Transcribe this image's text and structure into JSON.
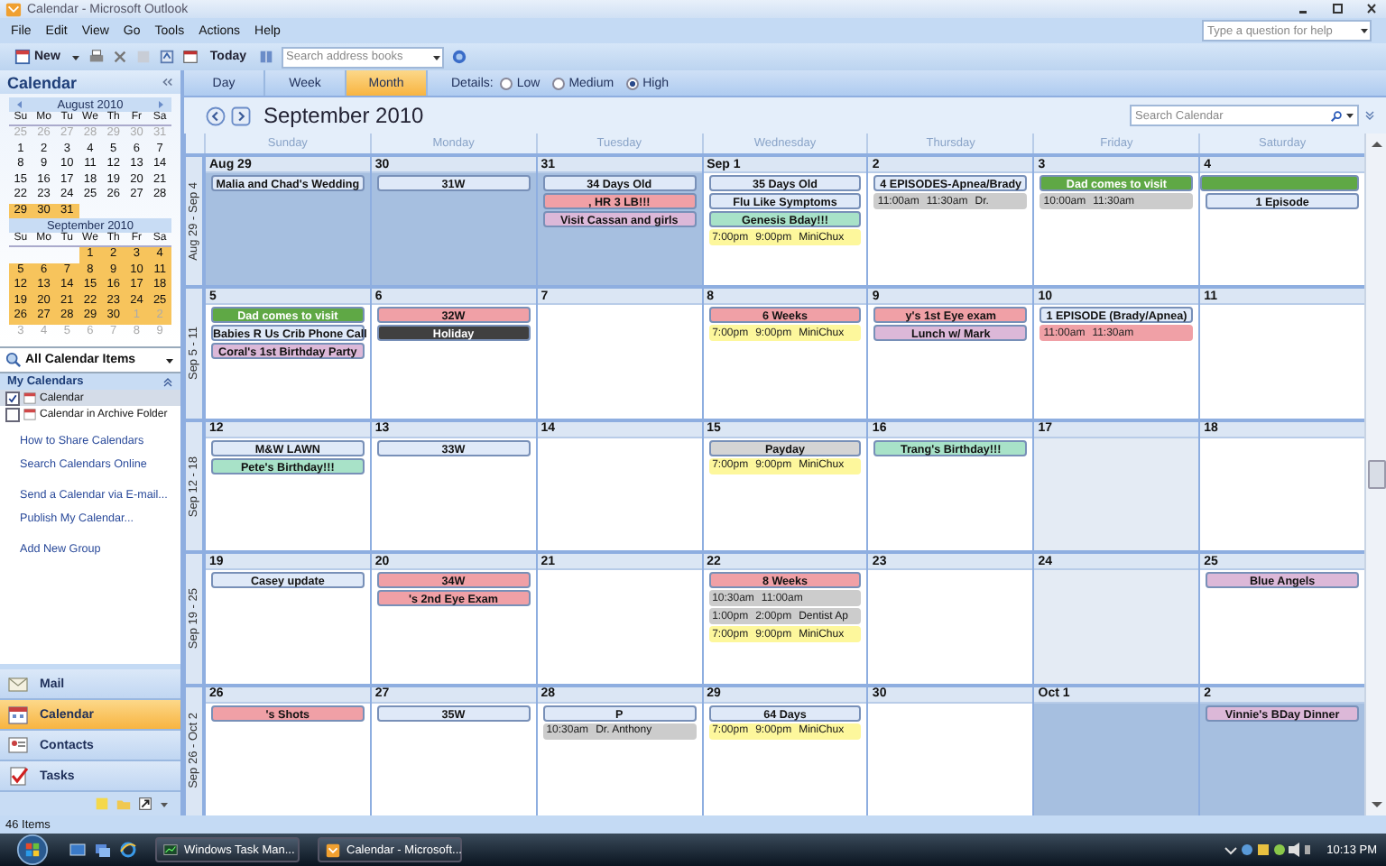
{
  "window": {
    "title": "Calendar - Microsoft Outlook"
  },
  "menu": [
    "File",
    "Edit",
    "View",
    "Go",
    "Tools",
    "Actions",
    "Help"
  ],
  "help_search": {
    "placeholder": "Type a question for help"
  },
  "toolbar": {
    "new_label": "New",
    "today_label": "Today",
    "address_search": {
      "placeholder": "Search address books"
    }
  },
  "sidebar": {
    "title": "Calendar",
    "mini_calendars": [
      {
        "title": "August 2010",
        "weekdays": [
          "Su",
          "Mo",
          "Tu",
          "We",
          "Th",
          "Fr",
          "Sa"
        ],
        "weeks": [
          [
            {
              "d": "25",
              "muted": true,
              "selected": false
            },
            {
              "d": "26",
              "muted": true,
              "selected": false
            },
            {
              "d": "27",
              "muted": true,
              "selected": false
            },
            {
              "d": "28",
              "muted": true,
              "selected": false
            },
            {
              "d": "29",
              "muted": true,
              "selected": false
            },
            {
              "d": "30",
              "muted": true,
              "selected": false
            },
            {
              "d": "31",
              "muted": true,
              "selected": false
            }
          ],
          [
            {
              "d": "1",
              "muted": false,
              "selected": false
            },
            {
              "d": "2",
              "muted": false,
              "selected": false
            },
            {
              "d": "3",
              "muted": false,
              "selected": false
            },
            {
              "d": "4",
              "muted": false,
              "selected": false
            },
            {
              "d": "5",
              "muted": false,
              "selected": false
            },
            {
              "d": "6",
              "muted": false,
              "selected": false
            },
            {
              "d": "7",
              "muted": false,
              "selected": false
            }
          ],
          [
            {
              "d": "8",
              "muted": false,
              "selected": false
            },
            {
              "d": "9",
              "muted": false,
              "selected": false
            },
            {
              "d": "10",
              "muted": false,
              "selected": false
            },
            {
              "d": "11",
              "muted": false,
              "selected": false
            },
            {
              "d": "12",
              "muted": false,
              "selected": false
            },
            {
              "d": "13",
              "muted": false,
              "selected": false
            },
            {
              "d": "14",
              "muted": false,
              "selected": false
            }
          ],
          [
            {
              "d": "15",
              "muted": false,
              "selected": false
            },
            {
              "d": "16",
              "muted": false,
              "selected": false
            },
            {
              "d": "17",
              "muted": false,
              "selected": false
            },
            {
              "d": "18",
              "muted": false,
              "selected": false
            },
            {
              "d": "19",
              "muted": false,
              "selected": false
            },
            {
              "d": "20",
              "muted": false,
              "selected": false
            },
            {
              "d": "21",
              "muted": false,
              "selected": false
            }
          ],
          [
            {
              "d": "22",
              "muted": false,
              "selected": false
            },
            {
              "d": "23",
              "muted": false,
              "selected": false
            },
            {
              "d": "24",
              "muted": false,
              "selected": false
            },
            {
              "d": "25",
              "muted": false,
              "selected": false
            },
            {
              "d": "26",
              "muted": false,
              "selected": false
            },
            {
              "d": "27",
              "muted": false,
              "selected": false
            },
            {
              "d": "28",
              "muted": false,
              "selected": false
            }
          ],
          [
            {
              "d": "29",
              "muted": false,
              "selected": true
            },
            {
              "d": "30",
              "muted": false,
              "selected": true
            },
            {
              "d": "31",
              "muted": false,
              "selected": true
            }
          ]
        ]
      },
      {
        "title": "September 2010",
        "weekdays": [
          "Su",
          "Mo",
          "Tu",
          "We",
          "Th",
          "Fr",
          "Sa"
        ],
        "weeks": [
          [
            {
              "d": "1",
              "muted": false,
              "selected": true
            },
            {
              "d": "2",
              "muted": false,
              "selected": true
            },
            {
              "d": "3",
              "muted": false,
              "selected": true
            },
            {
              "d": "4",
              "muted": false,
              "selected": true
            }
          ],
          [
            {
              "d": "5",
              "muted": false,
              "selected": true
            },
            {
              "d": "6",
              "muted": false,
              "selected": true
            },
            {
              "d": "7",
              "muted": false,
              "selected": true
            },
            {
              "d": "8",
              "muted": false,
              "selected": true
            },
            {
              "d": "9",
              "muted": false,
              "selected": true
            },
            {
              "d": "10",
              "muted": false,
              "selected": true
            },
            {
              "d": "11",
              "muted": false,
              "selected": true
            }
          ],
          [
            {
              "d": "12",
              "muted": false,
              "selected": true
            },
            {
              "d": "13",
              "muted": false,
              "selected": true
            },
            {
              "d": "14",
              "muted": false,
              "selected": true
            },
            {
              "d": "15",
              "muted": false,
              "selected": true
            },
            {
              "d": "16",
              "muted": false,
              "selected": true
            },
            {
              "d": "17",
              "muted": false,
              "selected": true
            },
            {
              "d": "18",
              "muted": false,
              "selected": true
            }
          ],
          [
            {
              "d": "19",
              "muted": false,
              "selected": true
            },
            {
              "d": "20",
              "muted": false,
              "selected": true
            },
            {
              "d": "21",
              "muted": false,
              "selected": true
            },
            {
              "d": "22",
              "muted": false,
              "selected": true
            },
            {
              "d": "23",
              "muted": false,
              "selected": true
            },
            {
              "d": "24",
              "muted": false,
              "selected": true
            },
            {
              "d": "25",
              "muted": false,
              "selected": true
            }
          ],
          [
            {
              "d": "26",
              "muted": false,
              "selected": true
            },
            {
              "d": "27",
              "muted": false,
              "selected": true
            },
            {
              "d": "28",
              "muted": false,
              "selected": true
            },
            {
              "d": "29",
              "muted": false,
              "selected": true
            },
            {
              "d": "30",
              "muted": false,
              "selected": true
            },
            {
              "d": "1",
              "muted": true,
              "selected": true
            },
            {
              "d": "2",
              "muted": true,
              "selected": true
            }
          ],
          [
            {
              "d": "3",
              "muted": true,
              "selected": false
            },
            {
              "d": "4",
              "muted": true,
              "selected": false
            },
            {
              "d": "5",
              "muted": true,
              "selected": false
            },
            {
              "d": "6",
              "muted": true,
              "selected": false
            },
            {
              "d": "7",
              "muted": true,
              "selected": false
            },
            {
              "d": "8",
              "muted": true,
              "selected": false
            },
            {
              "d": "9",
              "muted": true,
              "selected": false
            }
          ]
        ]
      }
    ],
    "view_dropdown": "All Calendar Items",
    "my_calendars": {
      "title": "My Calendars",
      "items": [
        {
          "label": "Calendar",
          "checked": true,
          "selected": true
        },
        {
          "label": "Calendar in Archive Folder",
          "checked": false,
          "selected": false
        }
      ]
    },
    "links": [
      "How to Share Calendars",
      "Search Calendars Online",
      "Send a Calendar via E-mail...",
      "Publish My Calendar...",
      "Add New Group"
    ],
    "nav": [
      {
        "label": "Mail",
        "kind": "mail",
        "selected": false
      },
      {
        "label": "Calendar",
        "kind": "calendar",
        "selected": true
      },
      {
        "label": "Contacts",
        "kind": "contacts",
        "selected": false
      },
      {
        "label": "Tasks",
        "kind": "tasks",
        "selected": false
      }
    ]
  },
  "tabs": [
    {
      "label": "Day",
      "selected": false
    },
    {
      "label": "Week",
      "selected": false
    },
    {
      "label": "Month",
      "selected": true
    }
  ],
  "details": {
    "label": "Details:",
    "options": [
      {
        "label": "Low",
        "selected": false
      },
      {
        "label": "Medium",
        "selected": false
      },
      {
        "label": "High",
        "selected": true
      }
    ]
  },
  "month_title": "September 2010",
  "calendar_search": {
    "placeholder": "Search Calendar"
  },
  "day_names": [
    "Sunday",
    "Monday",
    "Tuesday",
    "Wednesday",
    "Thursday",
    "Friday",
    "Saturday"
  ],
  "weeks": [
    {
      "label": "Aug 29 - Sep 4",
      "days": [
        {
          "date": "Aug 29",
          "out_of_month": true,
          "shaded": false,
          "events": [
            {
              "kind": "allday",
              "title": "Malia and Chad's Wedding",
              "color": "#dfe9f8"
            }
          ]
        },
        {
          "date": "30",
          "out_of_month": true,
          "shaded": false,
          "events": [
            {
              "kind": "allday",
              "title": "31W",
              "color": "#dfe9f8"
            }
          ]
        },
        {
          "date": "31",
          "out_of_month": true,
          "shaded": false,
          "events": [
            {
              "kind": "allday",
              "title": "34 Days Old",
              "color": "#dfe9f8"
            },
            {
              "kind": "allday",
              "title": ", HR 3 LB!!!",
              "color": "#f0a0a6"
            },
            {
              "kind": "allday",
              "title": "Visit Cassan and girls",
              "color": "#dcb8d8"
            }
          ]
        },
        {
          "date": "Sep 1",
          "out_of_month": false,
          "shaded": false,
          "events": [
            {
              "kind": "allday",
              "title": "35 Days Old",
              "color": "#dfe9f8"
            },
            {
              "kind": "allday",
              "title": "Flu Like Symptoms",
              "color": "#dfe9f8"
            },
            {
              "kind": "allday",
              "title": "Genesis Bday!!!",
              "color": "#a8e2c8"
            },
            {
              "kind": "timed",
              "start": "7:00pm",
              "end": "9:00pm",
              "title": "MiniChux",
              "color": "#fdf79c"
            }
          ]
        },
        {
          "date": "2",
          "out_of_month": false,
          "shaded": false,
          "events": [
            {
              "kind": "allday",
              "title": "4 EPISODES-Apnea/Brady",
              "color": "#dfe9f8"
            },
            {
              "kind": "timed",
              "start": "11:00am",
              "end": "11:30am",
              "title": "Dr.",
              "color": "#cccccc"
            }
          ]
        },
        {
          "date": "3",
          "out_of_month": false,
          "shaded": false,
          "events": [
            {
              "kind": "allday",
              "title": "Dad comes to visit",
              "color": "#5fa845"
            },
            {
              "kind": "timed",
              "start": "10:00am",
              "end": "11:30am",
              "color": "#cccccc"
            }
          ]
        },
        {
          "date": "4",
          "out_of_month": false,
          "shaded": false,
          "events": [
            {
              "kind": "continuation",
              "color": "#5fa845"
            },
            {
              "kind": "allday",
              "title": "1 Episode",
              "color": "#dfe9f8"
            }
          ]
        }
      ]
    },
    {
      "label": "Sep 5 - 11",
      "days": [
        {
          "date": "5",
          "out_of_month": false,
          "shaded": false,
          "events": [
            {
              "kind": "allday",
              "title": "Dad comes to visit",
              "color": "#5fa845"
            },
            {
              "kind": "allday",
              "title": "Babies R Us Crib Phone Call",
              "color": "#dfe9f8"
            },
            {
              "kind": "allday",
              "title": "Coral's 1st Birthday Party",
              "color": "#dcb8d8"
            }
          ]
        },
        {
          "date": "6",
          "out_of_month": false,
          "shaded": false,
          "events": [
            {
              "kind": "allday",
              "title": "32W",
              "color": "#f0a0a6"
            },
            {
              "kind": "allday",
              "title": "Holiday",
              "color": "#404040"
            }
          ]
        },
        {
          "date": "7",
          "out_of_month": false,
          "shaded": false
        },
        {
          "date": "8",
          "out_of_month": false,
          "shaded": false,
          "events": [
            {
              "kind": "allday",
              "title": "6 Weeks",
              "color": "#f0a0a6"
            },
            {
              "kind": "timed",
              "start": "7:00pm",
              "end": "9:00pm",
              "title": "MiniChux",
              "color": "#fdf79c"
            }
          ]
        },
        {
          "date": "9",
          "out_of_month": false,
          "shaded": false,
          "events": [
            {
              "kind": "allday",
              "title": "y's 1st Eye exam",
              "color": "#f0a0a6"
            },
            {
              "kind": "allday",
              "title": "Lunch w/ Mark",
              "color": "#dcb8d8"
            }
          ]
        },
        {
          "date": "10",
          "out_of_month": false,
          "shaded": false,
          "events": [
            {
              "kind": "allday",
              "title": "1 EPISODE (Brady/Apnea)",
              "color": "#dfe9f8"
            },
            {
              "kind": "timed",
              "start": "11:00am",
              "end": "11:30am",
              "color": "#f0a0a6"
            }
          ]
        },
        {
          "date": "11",
          "out_of_month": false,
          "shaded": false
        }
      ]
    },
    {
      "label": "Sep 12 - 18",
      "days": [
        {
          "date": "12",
          "out_of_month": false,
          "shaded": false,
          "events": [
            {
              "kind": "allday",
              "title": "M&W LAWN",
              "color": "#dfe9f8"
            },
            {
              "kind": "allday",
              "title": "Pete's Birthday!!!",
              "color": "#a8e2c8"
            }
          ]
        },
        {
          "date": "13",
          "out_of_month": false,
          "shaded": false,
          "events": [
            {
              "kind": "allday",
              "title": "33W",
              "color": "#dfe9f8"
            }
          ]
        },
        {
          "date": "14",
          "out_of_month": false,
          "shaded": false
        },
        {
          "date": "15",
          "out_of_month": false,
          "shaded": false,
          "events": [
            {
              "kind": "allday",
              "title": "Payday",
              "color": "#d4d4d4"
            },
            {
              "kind": "timed",
              "start": "7:00pm",
              "end": "9:00pm",
              "title": "MiniChux",
              "color": "#fdf79c"
            }
          ]
        },
        {
          "date": "16",
          "out_of_month": false,
          "shaded": false,
          "events": [
            {
              "kind": "allday",
              "title": "Trang's Birthday!!!",
              "color": "#a8e2c8"
            }
          ]
        },
        {
          "date": "17",
          "out_of_month": false,
          "shaded": true
        },
        {
          "date": "18",
          "out_of_month": false,
          "shaded": false
        }
      ]
    },
    {
      "label": "Sep 19 - 25",
      "days": [
        {
          "date": "19",
          "out_of_month": false,
          "shaded": false,
          "events": [
            {
              "kind": "allday",
              "title": "Casey update",
              "color": "#dfe9f8"
            }
          ]
        },
        {
          "date": "20",
          "out_of_month": false,
          "shaded": false,
          "events": [
            {
              "kind": "allday",
              "title": "34W",
              "color": "#f0a0a6"
            },
            {
              "kind": "allday",
              "title": "'s 2nd Eye Exam",
              "color": "#f0a0a6"
            }
          ]
        },
        {
          "date": "21",
          "out_of_month": false,
          "shaded": false
        },
        {
          "date": "22",
          "out_of_month": false,
          "shaded": false,
          "events": [
            {
              "kind": "allday",
              "title": "8 Weeks",
              "color": "#f0a0a6"
            },
            {
              "kind": "timed",
              "start": "10:30am",
              "end": "11:00am",
              "color": "#cccccc"
            },
            {
              "kind": "timed",
              "start": "1:00pm",
              "end": "2:00pm",
              "title": "Dentist Ap",
              "color": "#cccccc"
            },
            {
              "kind": "timed",
              "start": "7:00pm",
              "end": "9:00pm",
              "title": "MiniChux",
              "color": "#fdf79c"
            }
          ]
        },
        {
          "date": "23",
          "out_of_month": false,
          "shaded": false
        },
        {
          "date": "24",
          "out_of_month": false,
          "shaded": true
        },
        {
          "date": "25",
          "out_of_month": false,
          "shaded": false,
          "events": [
            {
              "kind": "allday",
              "title": "Blue Angels",
              "color": "#dcb8d8"
            }
          ]
        }
      ]
    },
    {
      "label": "Sep 26 - Oct 2",
      "days": [
        {
          "date": "26",
          "out_of_month": false,
          "shaded": false,
          "events": [
            {
              "kind": "allday",
              "title": "'s Shots",
              "color": "#f0a0a6"
            }
          ]
        },
        {
          "date": "27",
          "out_of_month": false,
          "shaded": false,
          "events": [
            {
              "kind": "allday",
              "title": "35W",
              "color": "#dfe9f8"
            }
          ]
        },
        {
          "date": "28",
          "out_of_month": false,
          "shaded": false,
          "events": [
            {
              "kind": "allday",
              "title": "P",
              "color": "#dfe9f8"
            },
            {
              "kind": "timed",
              "start": "10:30am",
              "title": "Dr. Anthony",
              "color": "#cccccc"
            }
          ]
        },
        {
          "date": "29",
          "out_of_month": false,
          "shaded": false,
          "events": [
            {
              "kind": "allday",
              "title": "64 Days",
              "color": "#dfe9f8"
            },
            {
              "kind": "timed",
              "start": "7:00pm",
              "end": "9:00pm",
              "title": "MiniChux",
              "color": "#fdf79c"
            }
          ]
        },
        {
          "date": "30",
          "out_of_month": false,
          "shaded": false
        },
        {
          "date": "Oct 1",
          "out_of_month": true,
          "shaded": false
        },
        {
          "date": "2",
          "out_of_month": true,
          "shaded": false,
          "events": [
            {
              "kind": "allday",
              "title": "Vinnie's BDay Dinner",
              "color": "#dcb8d8"
            }
          ]
        }
      ]
    }
  ],
  "status_bar": "46 Items",
  "taskbar": {
    "windows": [
      "Windows Task Man...",
      "Calendar - Microsoft..."
    ],
    "clock": "10:13 PM"
  }
}
